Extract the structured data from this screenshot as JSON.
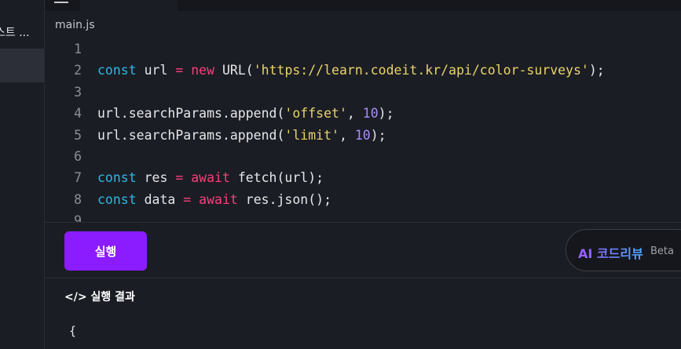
{
  "sidebar": {
    "item_label": "스트 ..."
  },
  "editor": {
    "filename": "main.js",
    "lines": [
      {
        "number": "1",
        "tokens": []
      },
      {
        "number": "2",
        "tokens": [
          {
            "t": "const",
            "c": "kw"
          },
          {
            "t": " url ",
            "c": ""
          },
          {
            "t": "=",
            "c": "op"
          },
          {
            "t": " ",
            "c": ""
          },
          {
            "t": "new",
            "c": "op"
          },
          {
            "t": " URL(",
            "c": ""
          },
          {
            "t": "'https://learn.codeit.kr/api/color-surveys'",
            "c": "str"
          },
          {
            "t": ");",
            "c": ""
          }
        ]
      },
      {
        "number": "3",
        "tokens": []
      },
      {
        "number": "4",
        "tokens": [
          {
            "t": "url.searchParams.append(",
            "c": ""
          },
          {
            "t": "'offset'",
            "c": "str"
          },
          {
            "t": ", ",
            "c": ""
          },
          {
            "t": "10",
            "c": "num"
          },
          {
            "t": ");",
            "c": ""
          }
        ]
      },
      {
        "number": "5",
        "tokens": [
          {
            "t": "url.searchParams.append(",
            "c": ""
          },
          {
            "t": "'limit'",
            "c": "str"
          },
          {
            "t": ", ",
            "c": ""
          },
          {
            "t": "10",
            "c": "num"
          },
          {
            "t": ");",
            "c": ""
          }
        ]
      },
      {
        "number": "6",
        "tokens": []
      },
      {
        "number": "7",
        "tokens": [
          {
            "t": "const",
            "c": "kw"
          },
          {
            "t": " res ",
            "c": ""
          },
          {
            "t": "=",
            "c": "op"
          },
          {
            "t": " ",
            "c": ""
          },
          {
            "t": "await",
            "c": "aw"
          },
          {
            "t": " fetch(url);",
            "c": ""
          }
        ]
      },
      {
        "number": "8",
        "tokens": [
          {
            "t": "const",
            "c": "kw"
          },
          {
            "t": " data ",
            "c": ""
          },
          {
            "t": "=",
            "c": "op"
          },
          {
            "t": " ",
            "c": ""
          },
          {
            "t": "await",
            "c": "aw"
          },
          {
            "t": " res.json();",
            "c": ""
          }
        ]
      },
      {
        "number": "9",
        "tokens": []
      }
    ]
  },
  "toolbar": {
    "run_label": "실행",
    "ai_review_label": "AI 코드리뷰",
    "beta_label": "Beta"
  },
  "result": {
    "title": "</> 실행 결과",
    "output": "{"
  },
  "colors": {
    "accent": "#8a1cff",
    "keyword": "#2fb7e8",
    "operator": "#f5417a",
    "string": "#e9d36b",
    "number": "#a98bff"
  }
}
